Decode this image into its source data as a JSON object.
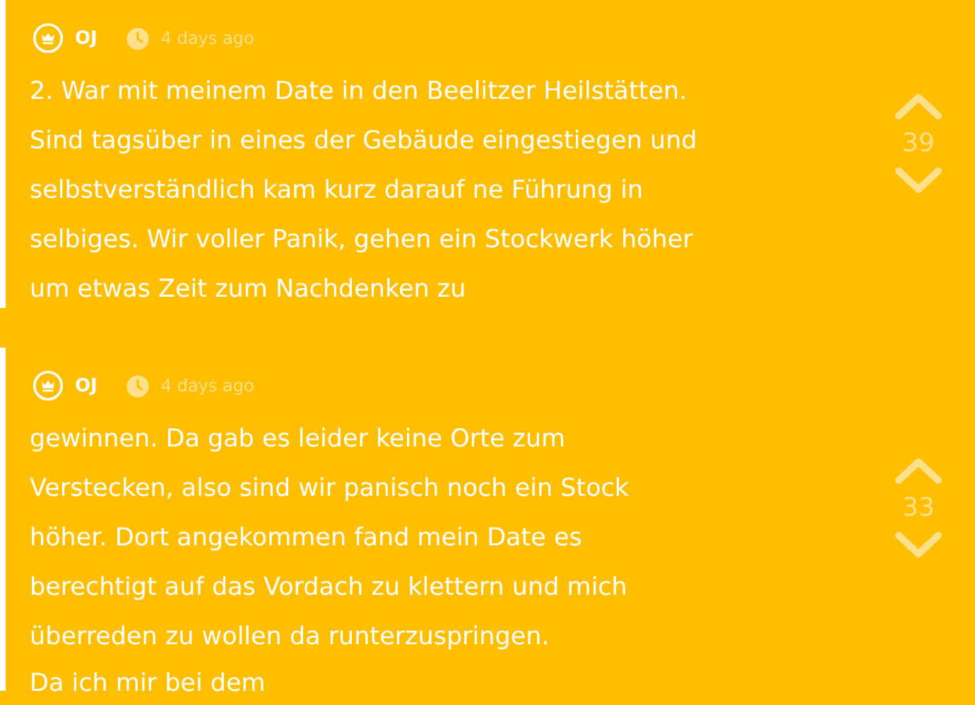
{
  "comments": [
    {
      "author": "OJ",
      "time": "4 days ago",
      "paragraphs": [
        [
          "2. War mit meinem Date in den Beelitzer Heilstätten.",
          "Sind tagsüber in eines der Gebäude eingestiegen und",
          "selbstverständlich kam kurz darauf ne Führung in",
          "selbiges. Wir voller Panik, gehen ein Stockwerk höher",
          "um etwas Zeit zum Nachdenken zu"
        ]
      ],
      "votes": "39"
    },
    {
      "author": "OJ",
      "time": "4 days ago",
      "paragraphs": [
        [
          "gewinnen. Da gab es leider keine Orte zum",
          "Verstecken, also sind wir panisch noch ein Stock",
          "höher. Dort angekommen fand mein Date es",
          "berechtigt auf das Vordach zu klettern und mich",
          "überreden zu wollen da runterzuspringen."
        ],
        [
          "Da ich mir bei dem"
        ]
      ],
      "votes": "33"
    }
  ]
}
